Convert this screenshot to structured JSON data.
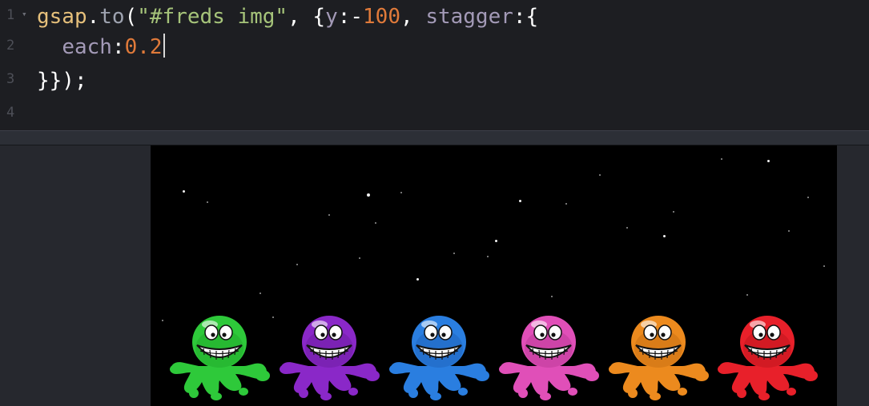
{
  "editor": {
    "lines": [
      {
        "number": "1",
        "tokens": [
          {
            "t": "gsap",
            "c": "c-obj"
          },
          {
            "t": ".",
            "c": "c-pun"
          },
          {
            "t": "to",
            "c": "c-fn"
          },
          {
            "t": "(",
            "c": "c-pun"
          },
          {
            "t": "\"#freds img\"",
            "c": "c-str"
          },
          {
            "t": ", {",
            "c": "c-pun"
          },
          {
            "t": "y",
            "c": "c-key"
          },
          {
            "t": ":-",
            "c": "c-pun"
          },
          {
            "t": "100",
            "c": "c-num"
          },
          {
            "t": ", ",
            "c": "c-pun"
          },
          {
            "t": "stagger",
            "c": "c-key"
          },
          {
            "t": ":{",
            "c": "c-pun"
          }
        ]
      },
      {
        "number": "2",
        "tokens": [
          {
            "t": "  ",
            "c": "c-pun"
          },
          {
            "t": "each",
            "c": "c-key"
          },
          {
            "t": ":",
            "c": "c-pun"
          },
          {
            "t": "0.2",
            "c": "c-num"
          }
        ]
      },
      {
        "number": "3",
        "tokens": [
          {
            "t": "}});",
            "c": "c-pun"
          }
        ]
      },
      {
        "number": "4",
        "tokens": []
      }
    ]
  },
  "preview": {
    "freds": [
      {
        "name": "fred-green",
        "color": "#2ec93a",
        "shade": "#1a9a24"
      },
      {
        "name": "fred-purple",
        "color": "#8a28c8",
        "shade": "#5e168f"
      },
      {
        "name": "fred-blue",
        "color": "#2a7ee0",
        "shade": "#1a56a8"
      },
      {
        "name": "fred-pink",
        "color": "#e04fb8",
        "shade": "#a83288"
      },
      {
        "name": "fred-orange",
        "color": "#ec8a1e",
        "shade": "#b8620e"
      },
      {
        "name": "fred-red",
        "color": "#e8202a",
        "shade": "#a81218"
      }
    ]
  }
}
